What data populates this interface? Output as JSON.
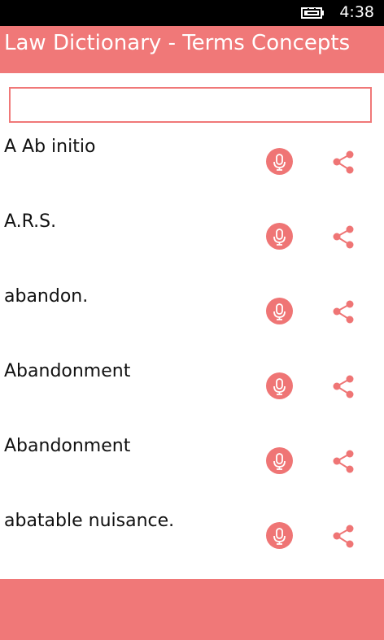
{
  "status_bar": {
    "time": "4:38",
    "battery_icon": "battery-charging-icon"
  },
  "app_bar": {
    "title": "Law Dictionary - Terms Concepts"
  },
  "search": {
    "value": "",
    "placeholder": ""
  },
  "terms": [
    {
      "label": "A Ab initio",
      "mic_icon": "microphone-icon",
      "share_icon": "share-icon"
    },
    {
      "label": "A.R.S.",
      "mic_icon": "microphone-icon",
      "share_icon": "share-icon"
    },
    {
      "label": "abandon.",
      "mic_icon": "microphone-icon",
      "share_icon": "share-icon"
    },
    {
      "label": "Abandonment",
      "mic_icon": "microphone-icon",
      "share_icon": "share-icon"
    },
    {
      "label": "Abandonment",
      "mic_icon": "microphone-icon",
      "share_icon": "share-icon"
    },
    {
      "label": "abatable nuisance.",
      "mic_icon": "microphone-icon",
      "share_icon": "share-icon"
    }
  ],
  "colors": {
    "accent": "#f07878",
    "status_bar": "#000000",
    "text": "#111111"
  }
}
